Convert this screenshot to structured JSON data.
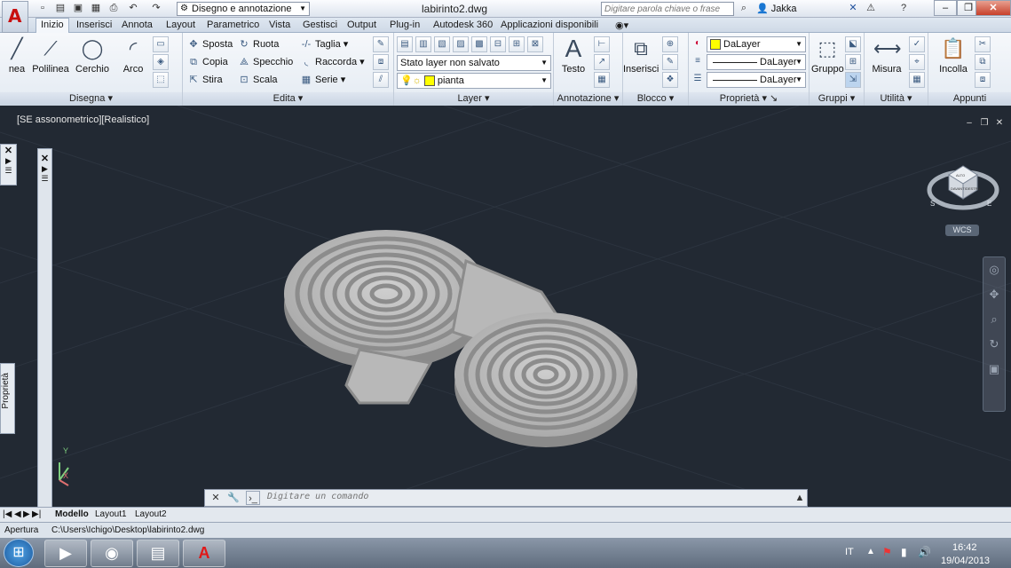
{
  "titlebar": {
    "workspace": "Disegno e annotazione",
    "document_title": "labirinto2.dwg",
    "search_placeholder": "Digitare parola chiave o frase",
    "user": "Jakka"
  },
  "ribbon_tabs": [
    "Inizio",
    "Inserisci",
    "Annota",
    "Layout",
    "Parametrico",
    "Vista",
    "Gestisci",
    "Output",
    "Plug-in",
    "Autodesk 360",
    "Applicazioni disponibili"
  ],
  "panels": {
    "disegna": {
      "title": "Disegna",
      "linea": "nea",
      "polilinea": "Polilinea",
      "cerchio": "Cerchio",
      "arco": "Arco"
    },
    "edita": {
      "title": "Edita",
      "sposta": "Sposta",
      "ruota": "Ruota",
      "taglia": "Taglia",
      "copia": "Copia",
      "specchio": "Specchio",
      "raccorda": "Raccorda",
      "stira": "Stira",
      "scala": "Scala",
      "serie": "Serie"
    },
    "layer": {
      "title": "Layer",
      "state": "Stato layer non salvato",
      "current": "pianta"
    },
    "annotazione": {
      "title": "Annotazione",
      "testo": "Testo"
    },
    "blocco": {
      "title": "Blocco",
      "inserisci": "Inserisci"
    },
    "proprieta": {
      "title": "Proprietà",
      "color": "DaLayer",
      "linetype": "DaLayer",
      "lineweight": "DaLayer"
    },
    "gruppi": {
      "title": "Gruppi",
      "gruppo": "Gruppo"
    },
    "utilita": {
      "title": "Utilità",
      "misura": "Misura"
    },
    "appunti": {
      "title": "Appunti",
      "incolla": "Incolla"
    }
  },
  "viewport": {
    "label": "[SE assonometrico][Realistico]",
    "wcs": "WCS",
    "properties_palette": "Proprietà",
    "viewcube_faces": {
      "top": "ALTO",
      "left": "DAVANTI",
      "right": "DESTRA"
    },
    "compass": {
      "s": "S",
      "e": "E"
    },
    "ucs": {
      "x": "X",
      "y": "Y"
    }
  },
  "command": {
    "placeholder": "Digitare un comando"
  },
  "layout_tabs": [
    "Modello",
    "Layout1",
    "Layout2"
  ],
  "statusbar": {
    "text": "Apertura",
    "path": "C:\\Users\\Ichigo\\Desktop\\labirinto2.dwg"
  },
  "taskbar": {
    "lang": "IT",
    "time": "16:42",
    "date": "19/04/2013"
  },
  "colors": {
    "accent": "#c81010",
    "viewport_bg": "#222933",
    "model_gray": "#b4b4b4"
  }
}
